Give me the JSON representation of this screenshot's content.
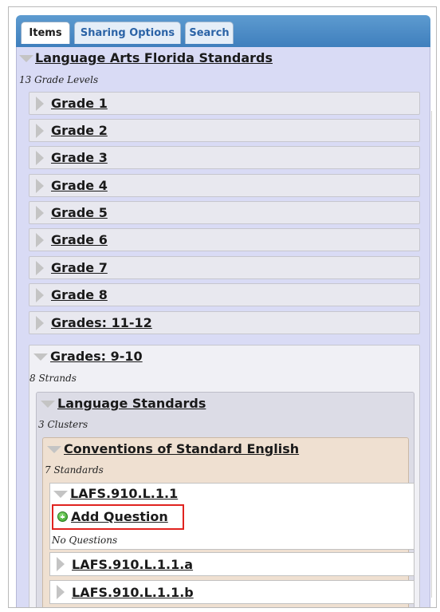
{
  "tabs": [
    "Items",
    "Sharing Options",
    "Search"
  ],
  "root": {
    "title": "Language Arts Florida Standards",
    "count_label": "13 Grade Levels"
  },
  "grades": [
    "Grade 1",
    "Grade 2",
    "Grade 3",
    "Grade 4",
    "Grade 5",
    "Grade 6",
    "Grade 7",
    "Grade 8",
    "Grades: 11-12"
  ],
  "open_grade": {
    "title": "Grades: 9-10",
    "count_label": "8 Strands",
    "strand": {
      "title": "Language Standards",
      "count_label": "3 Clusters",
      "cluster": {
        "title": "Conventions of Standard English",
        "count_label": "7 Standards",
        "standard": {
          "title": "LAFS.910.L.1.1",
          "add_label": "Add Question",
          "empty_label": "No Questions"
        },
        "siblings": [
          "LAFS.910.L.1.1.a",
          "LAFS.910.L.1.1.b"
        ]
      }
    }
  }
}
